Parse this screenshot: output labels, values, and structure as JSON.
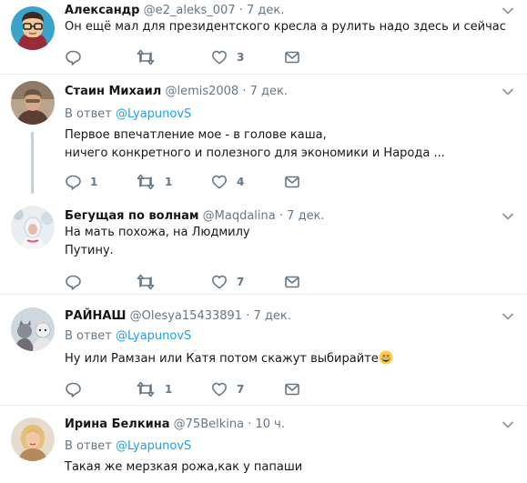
{
  "tweets": [
    {
      "name": "Александр",
      "handle": "@e2_aleks_007",
      "dot": "·",
      "time": "7 дек.",
      "reply_prefix": "",
      "reply_to": "",
      "lines": [
        "Он ещё мал для президентского кресла а рулить надо здесь и сейчас"
      ],
      "replies": "",
      "retweets": "",
      "likes": "3"
    },
    {
      "name": "Стаин Михаил",
      "handle": "@lemis2008",
      "dot": "·",
      "time": "7 дек.",
      "reply_prefix": "В ответ",
      "reply_to": "@LyapunovS",
      "lines": [
        "Первое впечатление мое - в голове каша,",
        "ничего конкретного и полезного для экономики и Народа ..."
      ],
      "replies": "1",
      "retweets": "1",
      "likes": "4"
    },
    {
      "name": "Бегущая по волнам",
      "handle": "@Maqdalina",
      "dot": "·",
      "time": "7 дек.",
      "reply_prefix": "",
      "reply_to": "",
      "lines": [
        "На мать похожа, на Людмилу",
        "Путину."
      ],
      "replies": "",
      "retweets": "",
      "likes": "7"
    },
    {
      "name": "РАЙНАШ",
      "handle": "@Olesya15433891",
      "dot": "·",
      "time": "7 дек.",
      "reply_prefix": "В ответ",
      "reply_to": "@LyapunovS",
      "lines": [
        "Ну или Рамзан или Катя потом скажут выбирайте"
      ],
      "emoji": "grinning-face-emoji",
      "replies": "",
      "retweets": "1",
      "likes": "7"
    },
    {
      "name": "Ирина Белкина",
      "handle": "@75Belkina",
      "dot": "·",
      "time": "10 ч.",
      "reply_prefix": "В ответ",
      "reply_to": "@LyapunovS",
      "lines": [
        "Такая же мерзкая рожа,как у папаши"
      ],
      "replies": "",
      "retweets": "",
      "likes": ""
    }
  ],
  "colors": {
    "link": "#1da1f2",
    "secondary": "#657786",
    "text": "#14171a",
    "separator": "#e6ecf0",
    "thread_line": "#c4cfd6"
  },
  "icons": [
    "reply-icon",
    "retweet-icon",
    "like-icon",
    "dm-icon",
    "chevron-down-icon"
  ]
}
